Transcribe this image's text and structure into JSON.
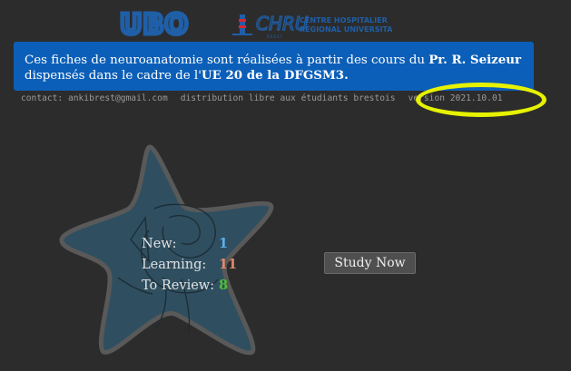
{
  "logos": {
    "ubo_text": "UBO",
    "chru_text": "CHRU",
    "chru_subtitle_line1": "CENTRE HOSPITALIER",
    "chru_subtitle_line2": "RÉGIONAL UNIVERSITAIRE",
    "chru_small": "BREST"
  },
  "banner": {
    "text_part1": "Ces fiches de neuroanatomie sont réalisées à partir des cours du ",
    "author": "Pr. R. Seizeur",
    "text_part2": "dispensés dans le cadre de l'",
    "course": "UE 20 de la DFGSM3."
  },
  "info": {
    "contact": "contact: ankibrest@gmail.com",
    "distribution": "distribution libre aux étudiants brestois",
    "version": "version 2021.10.01"
  },
  "stats": {
    "new_label": "New:",
    "new_value": "1",
    "learning_label": "Learning:",
    "learning_value": "11",
    "review_label": "To Review:",
    "review_value": "8"
  },
  "study_button": "Study Now",
  "colors": {
    "background": "#2c2c2c",
    "banner": "#0c5fb8",
    "highlight": "#e6f200",
    "new": "#5ab0ee",
    "learning": "#e2886a",
    "review": "#4fbe3a",
    "star_fill": "#2f4f60",
    "logo_blue": "#1f5fa8"
  }
}
